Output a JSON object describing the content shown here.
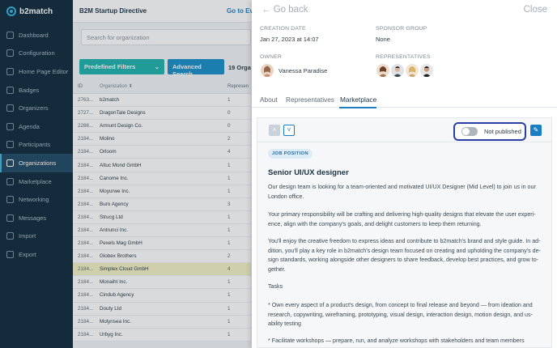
{
  "app": {
    "logo_text": "b2match",
    "event_title": "B2M Startup Directive",
    "goto_label": "Go to Eve"
  },
  "sidebar": {
    "items": [
      {
        "label": "Dashboard",
        "icon": "dashboard-icon",
        "active": false
      },
      {
        "label": "Configuration",
        "icon": "gear-icon",
        "active": false
      },
      {
        "label": "Home Page Editor",
        "icon": "home-icon",
        "active": false
      },
      {
        "label": "Badges",
        "icon": "badge-icon",
        "active": false
      },
      {
        "label": "Organizers",
        "icon": "organizers-icon",
        "active": false
      },
      {
        "label": "Agenda",
        "icon": "calendar-icon",
        "active": false
      },
      {
        "label": "Participants",
        "icon": "users-icon",
        "active": false
      },
      {
        "label": "Organizations",
        "icon": "building-icon",
        "active": true
      },
      {
        "label": "Marketplace",
        "icon": "cart-icon",
        "active": false
      },
      {
        "label": "Networking",
        "icon": "network-icon",
        "active": false
      },
      {
        "label": "Messages",
        "icon": "message-icon",
        "active": false
      },
      {
        "label": "Import",
        "icon": "import-icon",
        "active": false
      },
      {
        "label": "Export",
        "icon": "export-icon",
        "active": false
      }
    ]
  },
  "main": {
    "search_placeholder": "Search for organization",
    "filter_label": "Predefined Filters",
    "advanced_search_label": "Advanced Search",
    "count_text": "19 Orga",
    "table": {
      "headers": {
        "id": "ID",
        "org": "Organization",
        "rep": "Represen"
      },
      "rows": [
        {
          "id": "2763...",
          "org": "b2match",
          "rep": "1"
        },
        {
          "id": "2727...",
          "org": "DragonTale Designs",
          "rep": "0"
        },
        {
          "id": "2286...",
          "org": "Armunt Design Co.",
          "rep": "0"
        },
        {
          "id": "2184...",
          "org": "Molino",
          "rep": "2"
        },
        {
          "id": "2184...",
          "org": "Orloom",
          "rep": "4"
        },
        {
          "id": "2184...",
          "org": "Altuc Mond GmbH",
          "rep": "1"
        },
        {
          "id": "2184...",
          "org": "Canome Inc.",
          "rep": "1"
        },
        {
          "id": "2184...",
          "org": "Moyurwe Inc.",
          "rep": "1"
        },
        {
          "id": "2184...",
          "org": "Buro Agency",
          "rep": "3"
        },
        {
          "id": "2184...",
          "org": "Strucg Ltd",
          "rep": "1"
        },
        {
          "id": "2184...",
          "org": "Antrunci Inc.",
          "rep": "1"
        },
        {
          "id": "2184...",
          "org": "Pexels Mag GmbH",
          "rep": "1"
        },
        {
          "id": "2184...",
          "org": "Globex Brothers",
          "rep": "2"
        },
        {
          "id": "2184...",
          "org": "Simplex Cloud GmbH",
          "rep": "4",
          "highlight": true
        },
        {
          "id": "2184...",
          "org": "Monaiht Inc.",
          "rep": "1"
        },
        {
          "id": "2184...",
          "org": "Cindub Agency",
          "rep": "1"
        },
        {
          "id": "2184...",
          "org": "Douty Ltd",
          "rep": "1"
        },
        {
          "id": "2184...",
          "org": "Molynsea Inc.",
          "rep": "1"
        },
        {
          "id": "2184...",
          "org": "Urbyg Inc.",
          "rep": "1"
        }
      ]
    }
  },
  "panel": {
    "back_label": "Go back",
    "close_label": "Close",
    "creation_date_label": "CREATION DATE",
    "creation_date_value": "Jan 27, 2023 at 14:07",
    "sponsor_group_label": "SPONSOR GROUP",
    "sponsor_group_value": "None",
    "owner_label": "OWNER",
    "owner_name": "Vanessa Paradise",
    "representatives_label": "REPRESENTATIVES",
    "tabs": [
      "About",
      "Representatives",
      "Marketplace"
    ],
    "active_tab": "Marketplace",
    "publish_status": "Not published",
    "badge": "JOB POSITION",
    "job_title": "Senior UI/UX designer",
    "paragraphs": [
      "Our design team is looking for a team-oriented and motivated UI/UX Designer (Mid Level) to join us in our London office.",
      "Your primary responsibility will be crafting and delivering high-quality designs that elevate the user experi-ence, align with the company's goals, and delight customers to keep them returning.",
      "You'll enjoy the creative freedom to express ideas and contribute to b2match's brand and style guide. In ad-dition, you'll play a key role in b2match's design team focused on creating and upholding the company's de-sign standards, working alongside other designers to share feedback, develop best practices, and grow to-gether.",
      "Tasks",
      "*   Own every aspect of a product's design, from concept to final release and beyond — from ideation and research, copywriting, wireframing, prototyping, visual design, interaction design, motion design, and us-ability testing",
      "*   Facilitate workshops — prepare, run, and analyze workshops with stakeholders and team members"
    ]
  }
}
